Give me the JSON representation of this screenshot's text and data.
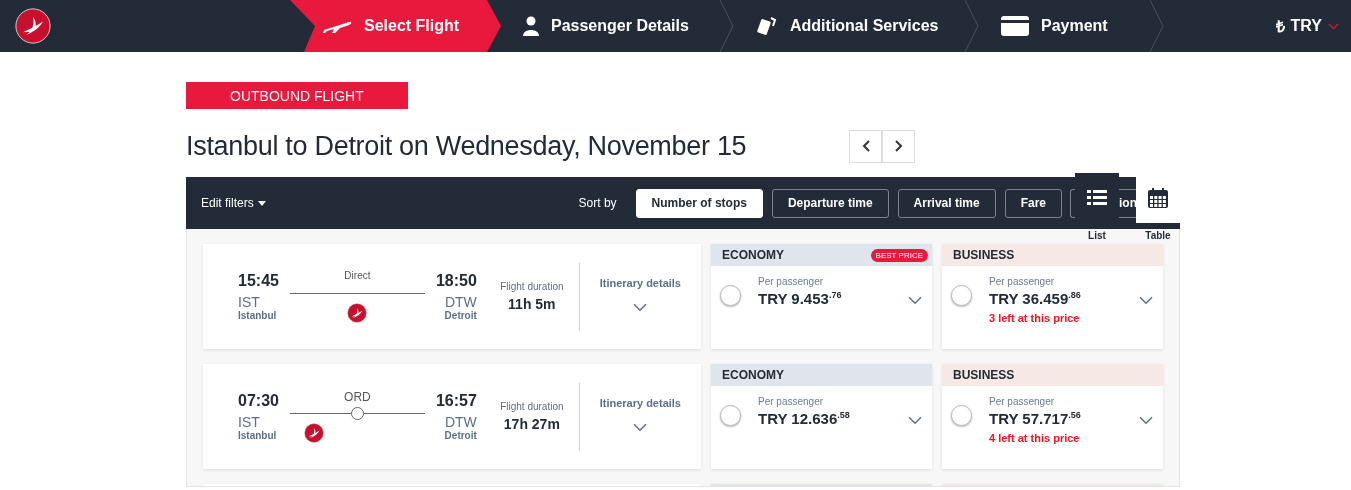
{
  "header": {
    "steps": [
      {
        "label": "Select Flight",
        "selected": true
      },
      {
        "label": "Passenger Details",
        "selected": false
      },
      {
        "label": "Additional Services",
        "selected": false
      },
      {
        "label": "Payment",
        "selected": false
      }
    ],
    "currency": {
      "symbol": "₺",
      "code": "TRY"
    }
  },
  "badge": "OUTBOUND FLIGHT",
  "title": "Istanbul to Detroit on Wednesday, November 15",
  "filter_bar": {
    "edit_filters": "Edit filters",
    "sort_label": "Sort by",
    "sort_options": [
      {
        "label": "Number of stops",
        "selected": true
      },
      {
        "label": "Departure time",
        "selected": false
      },
      {
        "label": "Arrival time",
        "selected": false
      },
      {
        "label": "Fare",
        "selected": false
      },
      {
        "label": "ion",
        "selected": false
      }
    ]
  },
  "view_toggle": [
    {
      "label": "List",
      "selected": true
    },
    {
      "label": "Table",
      "selected": false
    }
  ],
  "flights": [
    {
      "departure_time": "15:45",
      "departure_code": "IST",
      "departure_city": "Istanbul",
      "route_label": "Direct",
      "kind": "direct",
      "arrival_time": "18:50",
      "arrival_code": "DTW",
      "arrival_city": "Detroit",
      "duration_label": "Flight duration",
      "duration": "11h 5m",
      "details_label": "Itinerary details",
      "fares": [
        {
          "kind": "economy",
          "cabin": "ECONOMY",
          "tag": "BEST PRICE",
          "per": "Per passenger",
          "price": "TRY 9.453",
          "cents": ".76",
          "selected": false
        },
        {
          "kind": "business",
          "cabin": "BUSINESS",
          "per": "Per passenger",
          "price": "TRY 36.459",
          "cents": ".86",
          "note": "3 left at this price",
          "selected": false
        }
      ]
    },
    {
      "departure_time": "07:30",
      "departure_code": "IST",
      "departure_city": "Istanbul",
      "route_label": "ORD",
      "kind": "stop",
      "arrival_time": "16:57",
      "arrival_code": "DTW",
      "arrival_city": "Detroit",
      "duration_label": "Flight duration",
      "duration": "17h 27m",
      "details_label": "Itinerary details",
      "fares": [
        {
          "kind": "economy",
          "cabin": "ECONOMY",
          "per": "Per passenger",
          "price": "TRY 12.636",
          "cents": ".58",
          "selected": false
        },
        {
          "kind": "business",
          "cabin": "BUSINESS",
          "per": "Per passenger",
          "price": "TRY 57.717",
          "cents": ".56",
          "note": "4 left at this price",
          "selected": false
        }
      ]
    },
    {
      "kind": "cut",
      "fares": [
        {
          "kind": "economy"
        },
        {
          "kind": "business"
        }
      ]
    }
  ]
}
